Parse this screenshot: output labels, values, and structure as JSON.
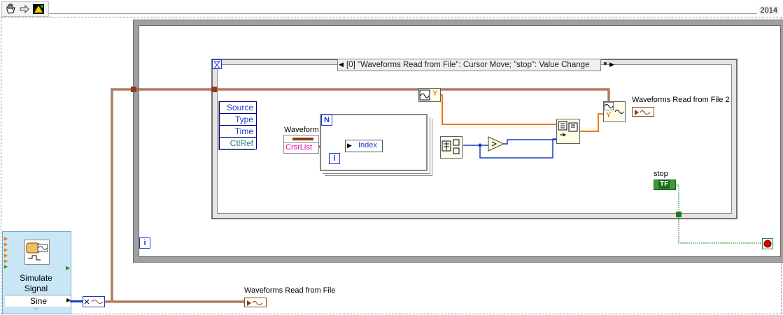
{
  "toolbar": {
    "hand_icon": "hand-icon",
    "arrow_icon": "arrow-right-icon",
    "highlight_icon": "highlight-icon"
  },
  "diagram": {
    "version": "2014"
  },
  "while_loop": {
    "iteration_label": "i"
  },
  "event_structure": {
    "case_label": "[0] \"Waveforms Read from File\": Cursor Move;  \"stop\": Value Change",
    "hourglass_icon": "hourglass-icon",
    "data_nodes": [
      "Source",
      "Type",
      "Time",
      "CtlRef"
    ]
  },
  "for_loop": {
    "count_label": "N",
    "iteration_label": "i"
  },
  "nodes": {
    "waveform_label": "Waveform",
    "crsrlist_label": "CrsrList",
    "index_label": "Index",
    "y_label_top": "Y",
    "y_label_right": "Y"
  },
  "indicators": {
    "waveforms_read_from_file_2": "Waveforms Read from File 2",
    "waveforms_read_from_file": "Waveforms Read from File",
    "stop_label": "stop",
    "stop_value": "TF"
  },
  "subvi": {
    "title_line1": "Simulate",
    "title_line2": "Signal",
    "selected": "Sine"
  },
  "colors": {
    "waveform_wire": "#8b3a1a",
    "double_wire": "#f07800",
    "int_wire": "#1a3cc8",
    "bool_wire": "#2a8a2a",
    "cluster_wire": "#e000a8"
  }
}
